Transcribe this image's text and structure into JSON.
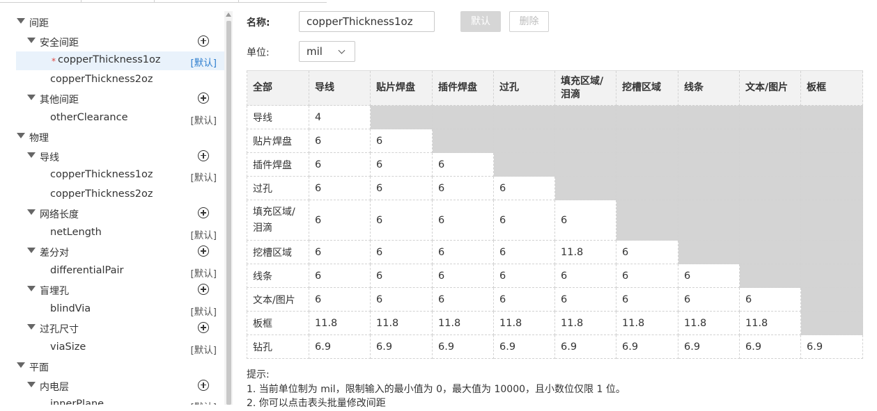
{
  "tree": {
    "nodes": [
      {
        "label": "间距",
        "level": 0,
        "expand": true
      },
      {
        "label": "安全间距",
        "level": 1,
        "expand": true,
        "add": true
      },
      {
        "label": "copperThickness1oz",
        "level": 2,
        "selected": true,
        "modified": true,
        "default_label": "[默认]"
      },
      {
        "label": "copperThickness2oz",
        "level": 2
      },
      {
        "label": "其他间距",
        "level": 1,
        "expand": true,
        "add": true
      },
      {
        "label": "otherClearance",
        "level": 2,
        "default_label": "[默认]"
      },
      {
        "label": "物理",
        "level": 0,
        "expand": true
      },
      {
        "label": "导线",
        "level": 1,
        "expand": true,
        "add": true
      },
      {
        "label": "copperThickness1oz",
        "level": 2,
        "default_label": "[默认]"
      },
      {
        "label": "copperThickness2oz",
        "level": 2
      },
      {
        "label": "网络长度",
        "level": 1,
        "expand": true,
        "add": true
      },
      {
        "label": "netLength",
        "level": 2,
        "default_label": "[默认]"
      },
      {
        "label": "差分对",
        "level": 1,
        "expand": true,
        "add": true
      },
      {
        "label": "differentialPair",
        "level": 2,
        "default_label": "[默认]"
      },
      {
        "label": "盲埋孔",
        "level": 1,
        "expand": true,
        "add": true
      },
      {
        "label": "blindVia",
        "level": 2,
        "default_label": "[默认]"
      },
      {
        "label": "过孔尺寸",
        "level": 1,
        "expand": true,
        "add": true
      },
      {
        "label": "viaSize",
        "level": 2,
        "default_label": "[默认]"
      },
      {
        "label": "平面",
        "level": 0,
        "expand": true
      },
      {
        "label": "内电层",
        "level": 1,
        "expand": true,
        "add": true
      },
      {
        "label": "innerPlane",
        "level": 2,
        "default_label": "[默认]"
      }
    ],
    "modified_mark": "*"
  },
  "form": {
    "name_label": "名称:",
    "name_value": "copperThickness1oz",
    "default_button": "默认",
    "delete_button": "删除",
    "unit_label": "单位:",
    "unit_value": "mil"
  },
  "matrix": {
    "corner": "全部",
    "columns": [
      "导线",
      "贴片焊盘",
      "插件焊盘",
      "过孔",
      "填充区域/泪滴",
      "挖槽区域",
      "线条",
      "文本/图片",
      "板框"
    ],
    "rows": [
      {
        "name": "导线",
        "values": [
          "4"
        ]
      },
      {
        "name": "贴片焊盘",
        "values": [
          "6",
          "6"
        ]
      },
      {
        "name": "插件焊盘",
        "values": [
          "6",
          "6",
          "6"
        ]
      },
      {
        "name": "过孔",
        "values": [
          "6",
          "6",
          "6",
          "6"
        ]
      },
      {
        "name": "填充区域/泪滴",
        "values": [
          "6",
          "6",
          "6",
          "6",
          "6"
        ]
      },
      {
        "name": "挖槽区域",
        "values": [
          "6",
          "6",
          "6",
          "6",
          "11.8",
          "6"
        ]
      },
      {
        "name": "线条",
        "values": [
          "6",
          "6",
          "6",
          "6",
          "6",
          "6",
          "6"
        ]
      },
      {
        "name": "文本/图片",
        "values": [
          "6",
          "6",
          "6",
          "6",
          "6",
          "6",
          "6",
          "6"
        ]
      },
      {
        "name": "板框",
        "values": [
          "11.8",
          "11.8",
          "11.8",
          "11.8",
          "11.8",
          "11.8",
          "11.8",
          "11.8"
        ]
      },
      {
        "name": "钻孔",
        "values": [
          "6.9",
          "6.9",
          "6.9",
          "6.9",
          "6.9",
          "6.9",
          "6.9",
          "6.9",
          "6.9"
        ]
      }
    ]
  },
  "hints": {
    "title": "提示:",
    "lines": [
      "1. 当前单位制为 mil，限制输入的最小值为 0，最大值为 10000，且小数位仅限 1 位。",
      "2. 你可以点击表头批量修改间距"
    ]
  },
  "colors": {
    "selected_bg": "#e9f2fb",
    "link_blue": "#2f7fcf",
    "disabled_cell": "#d4d4d4",
    "header_bg": "#f2f2f2",
    "modified_star": "#e0453d"
  }
}
